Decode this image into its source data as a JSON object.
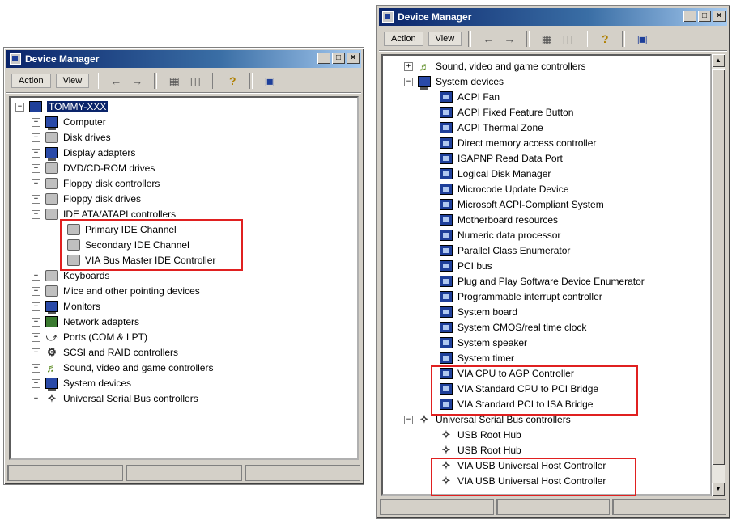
{
  "left_window": {
    "title": "Device Manager",
    "menu": {
      "action": "Action",
      "view": "View"
    },
    "tree": {
      "root": "TOMMY-XXX",
      "items": [
        "Computer",
        "Disk drives",
        "Display adapters",
        "DVD/CD-ROM drives",
        "Floppy disk controllers",
        "Floppy disk drives",
        "IDE ATA/ATAPI controllers",
        "Primary IDE Channel",
        "Secondary IDE Channel",
        "VIA Bus Master IDE Controller",
        "Keyboards",
        "Mice and other pointing devices",
        "Monitors",
        "Network adapters",
        "Ports (COM & LPT)",
        "SCSI and RAID controllers",
        "Sound, video and game controllers",
        "System devices",
        "Universal Serial Bus controllers"
      ]
    }
  },
  "right_window": {
    "title": "Device Manager",
    "menu": {
      "action": "Action",
      "view": "View"
    },
    "tree": {
      "items": [
        "Sound, video and game controllers",
        "System devices",
        "ACPI Fan",
        "ACPI Fixed Feature Button",
        "ACPI Thermal Zone",
        "Direct memory access controller",
        "ISAPNP Read Data Port",
        "Logical Disk Manager",
        "Microcode Update Device",
        "Microsoft ACPI-Compliant System",
        "Motherboard resources",
        "Numeric data processor",
        "Parallel Class Enumerator",
        "PCI bus",
        "Plug and Play Software Device Enumerator",
        "Programmable interrupt controller",
        "System board",
        "System CMOS/real time clock",
        "System speaker",
        "System timer",
        "VIA CPU to AGP Controller",
        "VIA Standard CPU to PCI Bridge",
        "VIA Standard PCI to ISA Bridge",
        "Universal Serial Bus controllers",
        "USB Root Hub",
        "USB Root Hub",
        "VIA USB Universal Host Controller",
        "VIA USB Universal Host Controller"
      ]
    }
  },
  "colors": {
    "highlight_box": "#e02020",
    "title_bar": "#0a246a"
  },
  "window_buttons": {
    "minimize": "_",
    "maximize": "□",
    "close": "×"
  }
}
